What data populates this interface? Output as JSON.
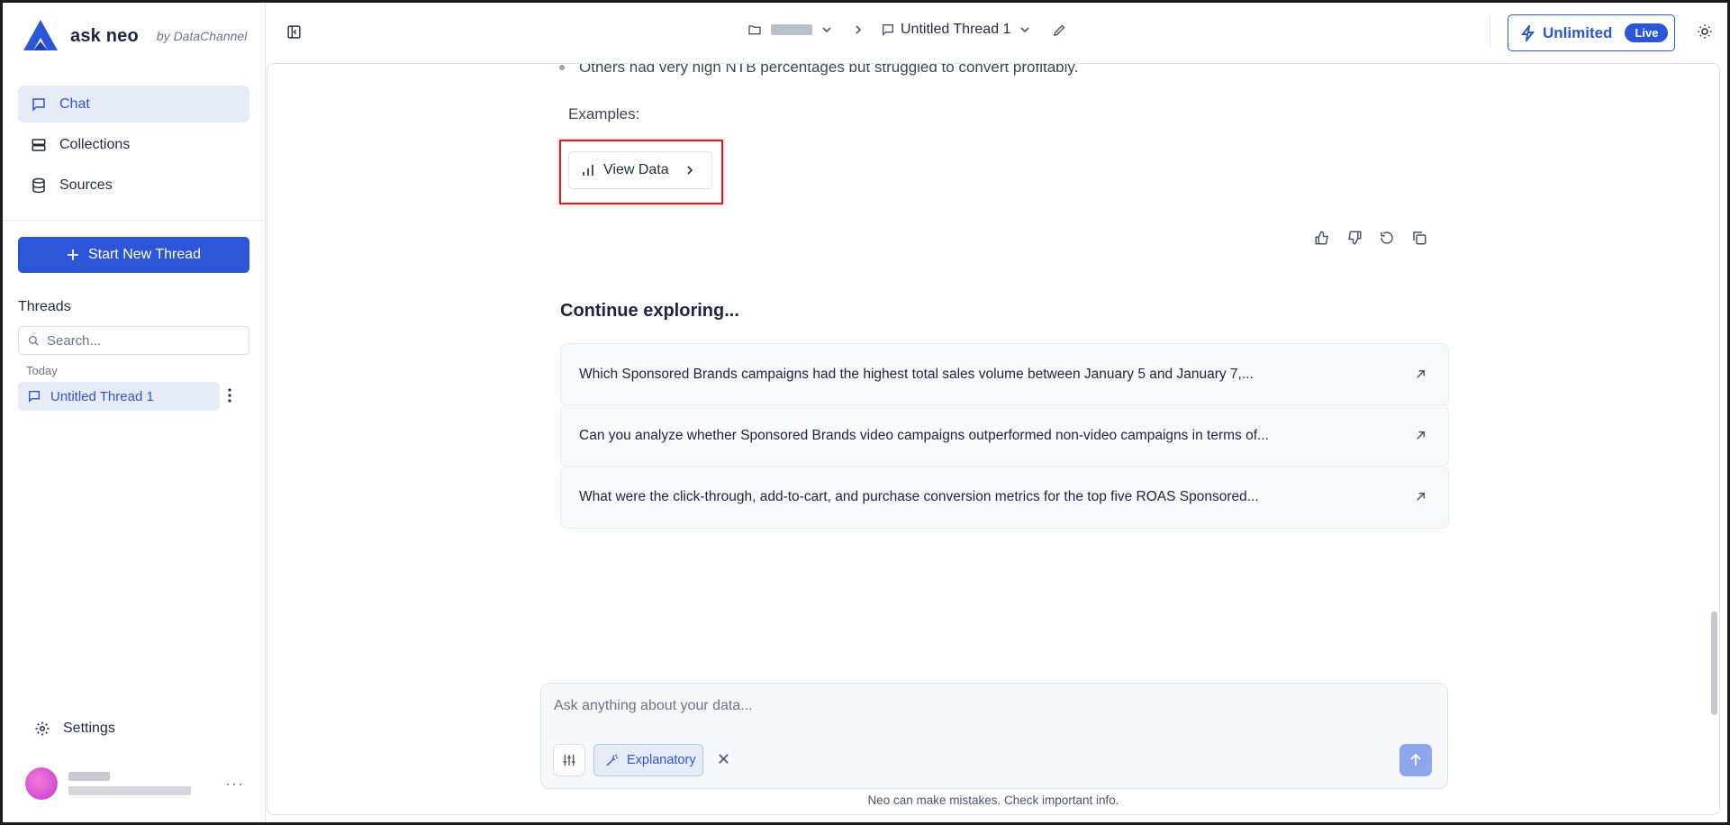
{
  "app": {
    "name": "ask neo",
    "by": "by DataChannel"
  },
  "sidebar": {
    "nav": [
      {
        "label": "Chat",
        "icon": "chat-icon"
      },
      {
        "label": "Collections",
        "icon": "collections-icon"
      },
      {
        "label": "Sources",
        "icon": "database-icon"
      }
    ],
    "new_thread_label": "Start New Thread",
    "threads_heading": "Threads",
    "search_placeholder": "Search...",
    "group_today": "Today",
    "threads": [
      {
        "label": "Untitled Thread 1"
      }
    ],
    "settings_label": "Settings"
  },
  "header": {
    "thread_title": "Untitled Thread 1",
    "plan_label": "Unlimited",
    "plan_status": "Live"
  },
  "message": {
    "bullet_text": "Others had very high NTB percentages but struggled to convert profitably.",
    "examples_label": "Examples:",
    "view_data_label": "View Data"
  },
  "continue": {
    "heading": "Continue exploring...",
    "suggestions": [
      "Which Sponsored Brands campaigns had the highest total sales volume between January 5 and January 7,...",
      "Can you analyze whether Sponsored Brands video campaigns outperformed non-video campaigns in terms of...",
      "What were the click-through, add-to-cart, and purchase conversion metrics for the top five ROAS Sponsored..."
    ]
  },
  "composer": {
    "placeholder": "Ask anything about your data...",
    "mode_label": "Explanatory"
  },
  "disclaimer": "Neo can make mistakes. Check important info.",
  "colors": {
    "accent": "#2b56d8",
    "highlight": "#e01c1c"
  }
}
